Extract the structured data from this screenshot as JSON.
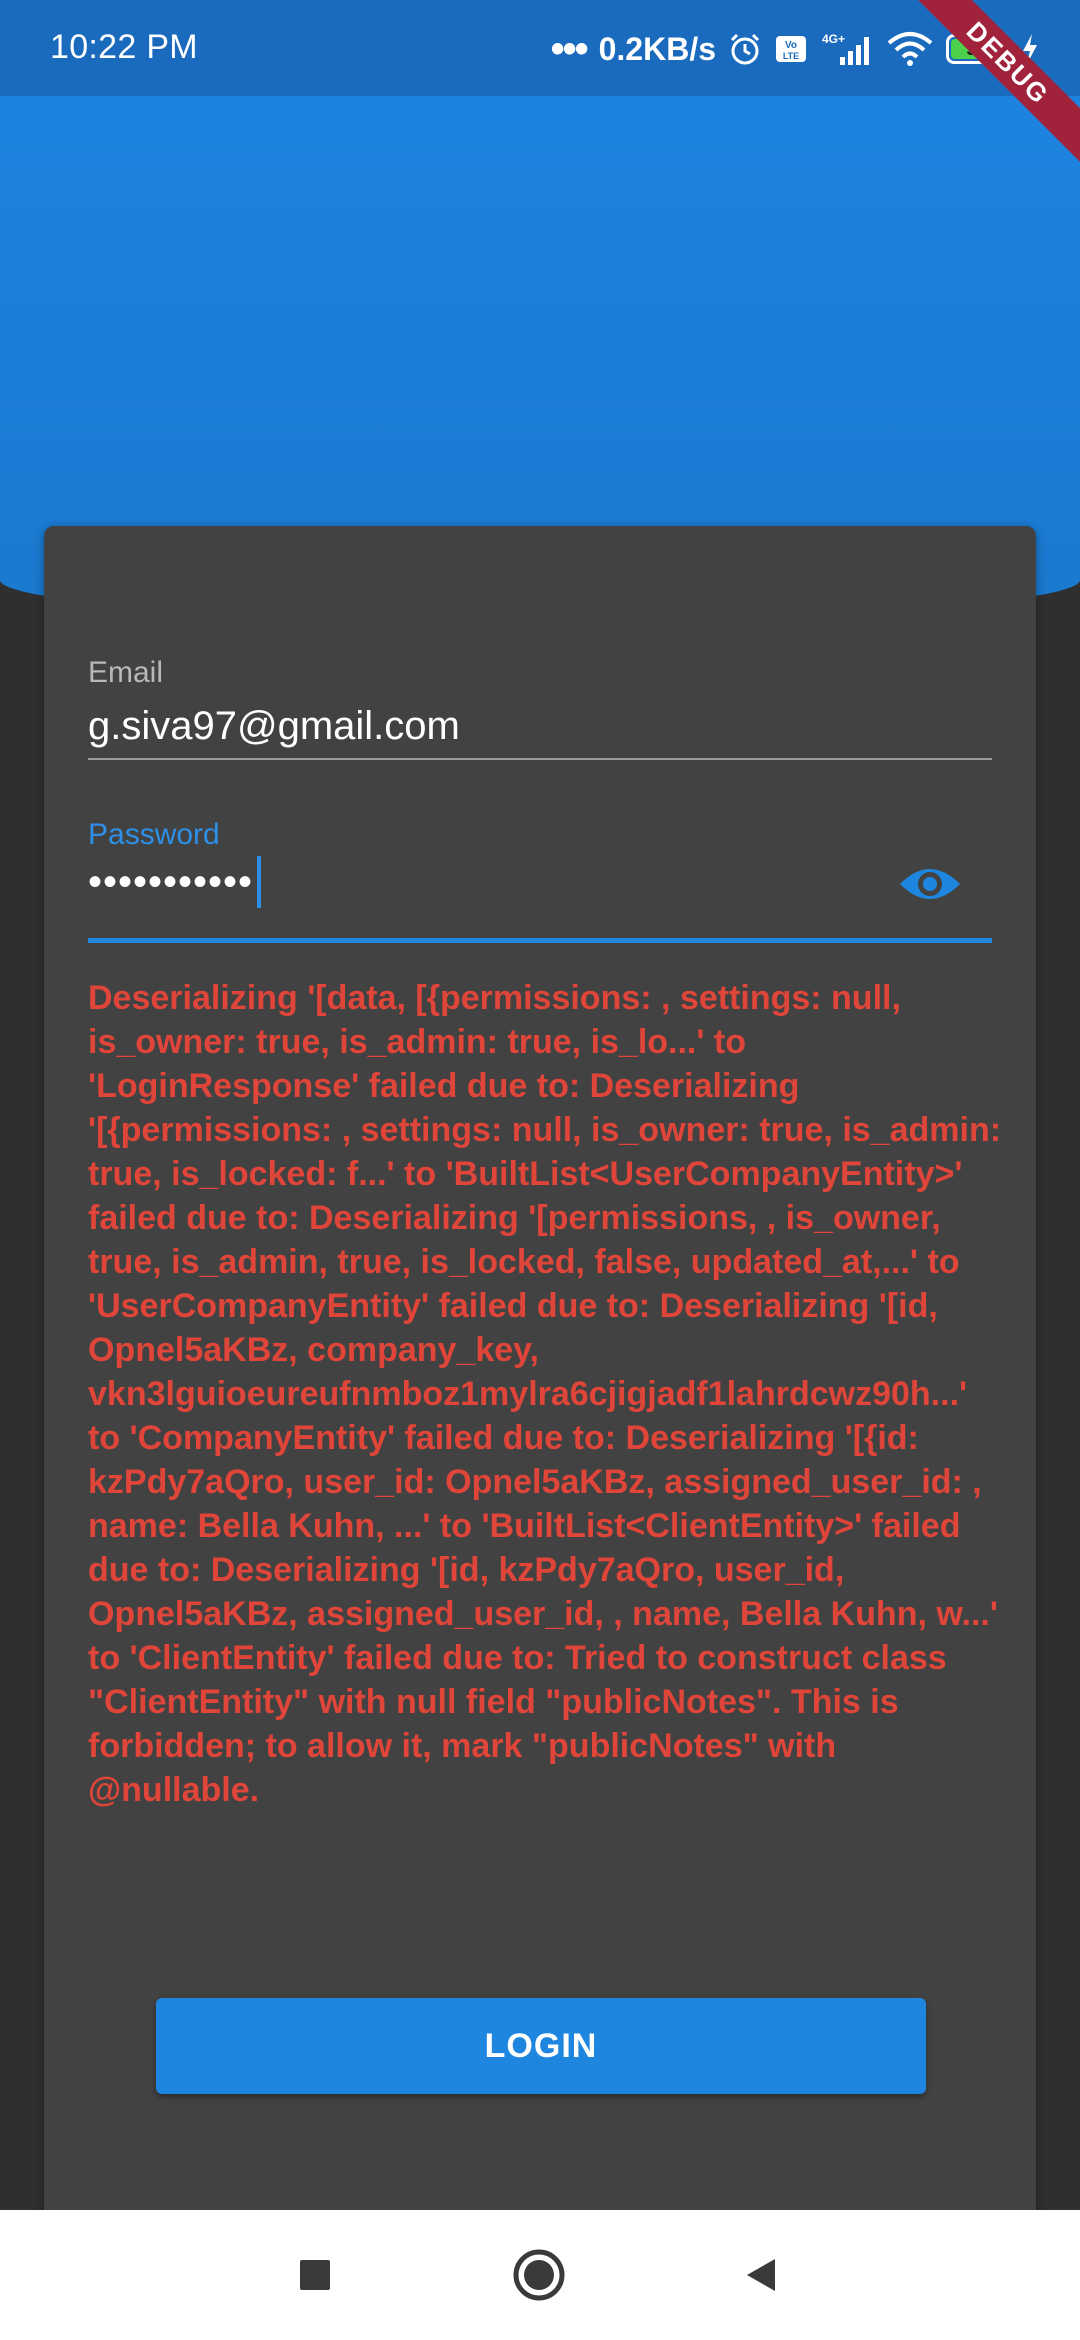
{
  "status_bar": {
    "time": "10:22 PM",
    "network_speed": "0.2KB/s",
    "network_type": "4G+",
    "volte": "Vo LTE",
    "battery_level": "99",
    "debug_label": "DEBUG"
  },
  "login_form": {
    "email": {
      "label": "Email",
      "value": "g.siva97@gmail.com"
    },
    "password": {
      "label": "Password",
      "masked_value": "•••••••••••"
    },
    "error_message": "Deserializing '[data, [{permissions: , settings: null, is_owner: true, is_admin: true, is_lo...' to 'LoginResponse' failed due to: Deserializing '[{permissions: , settings: null, is_owner: true, is_admin: true, is_locked: f...' to 'BuiltList<UserCompanyEntity>' failed due to: Deserializing '[permissions, , is_owner, true, is_admin, true, is_locked, false, updated_at,...' to 'UserCompanyEntity' failed due to: Deserializing '[id, Opnel5aKBz, company_key, vkn3lguioeureufnmboz1mylra6cjigjadf1lahrdcwz90h...' to 'CompanyEntity' failed due to: Deserializing '[{id: kzPdy7aQro, user_id: Opnel5aKBz, assigned_user_id: , name: Bella Kuhn, ...' to 'BuiltList<ClientEntity>' failed due to: Deserializing '[id, kzPdy7aQro, user_id, Opnel5aKBz, assigned_user_id, , name, Bella Kuhn, w...' to 'ClientEntity' failed due to: Tried to construct class \"ClientEntity\" with null field \"publicNotes\". This is forbidden; to allow it, mark \"publicNotes\" with @nullable.",
    "login_button_label": "LOGIN"
  },
  "nav_bar": {
    "recents_icon": "square-icon",
    "home_icon": "circle-icon",
    "back_icon": "triangle-back-icon"
  },
  "colors": {
    "primary_blue": "#1f86e0",
    "error_red": "#e0453a",
    "card_bg": "#424242",
    "page_bg": "#2f2f2f"
  }
}
